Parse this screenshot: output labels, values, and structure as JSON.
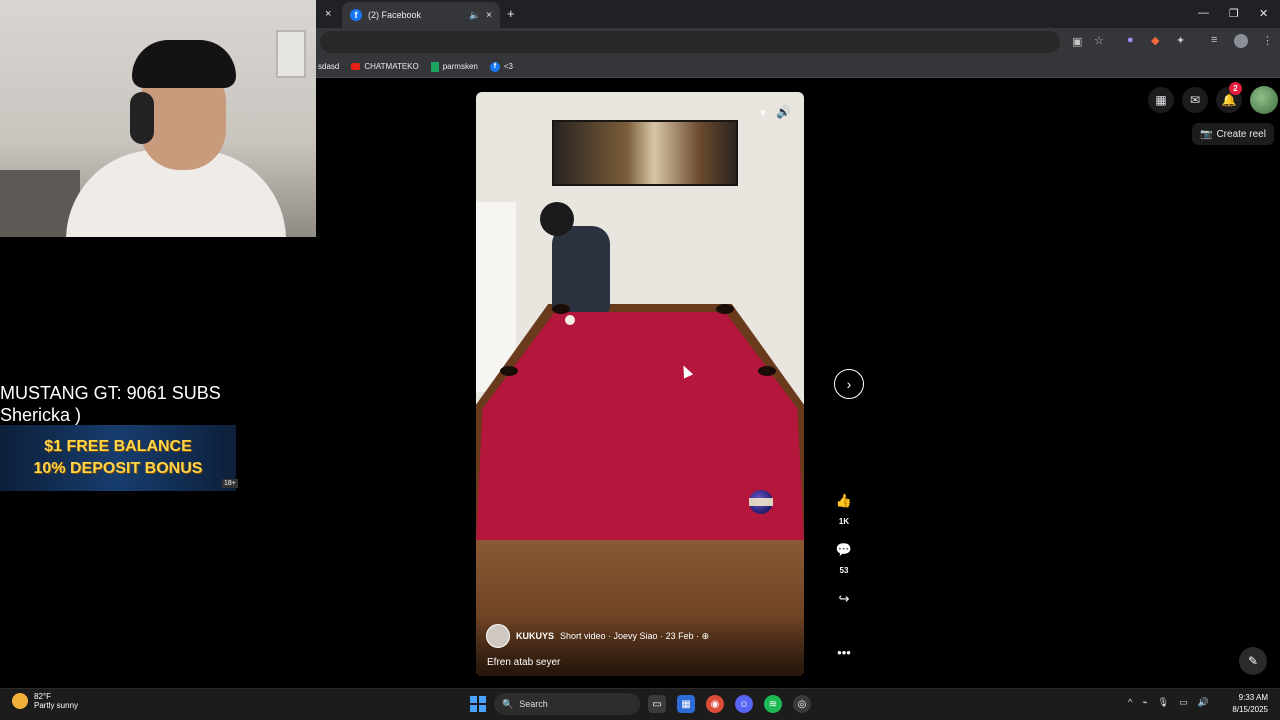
{
  "browser": {
    "tab_title": "(2) Facebook",
    "tab_close": "×",
    "tab_mute": "🔈",
    "new_tab": "+",
    "left_close": "×",
    "window_controls": {
      "minimize": "—",
      "restore": "❐",
      "close": "✕"
    },
    "bookmarks": [
      {
        "label": "sdasd"
      },
      {
        "label": "CHATMATEKO"
      },
      {
        "label": "parmsken"
      },
      {
        "label": "<3"
      }
    ]
  },
  "overlay": {
    "line1": "MUSTANG GT: 9061 SUBS",
    "line2": "Shericka )",
    "promo_line1": "$1 FREE BALANCE",
    "promo_line2": "10% DEPOSIT BONUS",
    "promo_age": "18+"
  },
  "reel": {
    "author": "KUKUYS",
    "meta": "Short video · Joevy Siao · 23 Feb · ⊕",
    "caption": "Efren atab seyer",
    "likes": "1K",
    "comments": "53"
  },
  "facebook": {
    "notification_count": "2",
    "create_reel_label": "Create reel"
  },
  "taskbar": {
    "temperature": "82°F",
    "weather": "Partly sunny",
    "search_label": "Search",
    "time": "9:33 AM",
    "date": "8/15/2025"
  },
  "colors": {
    "accent_facebook": "#1877f2",
    "felt": "#b5163c",
    "badge": "#e41e3f"
  }
}
